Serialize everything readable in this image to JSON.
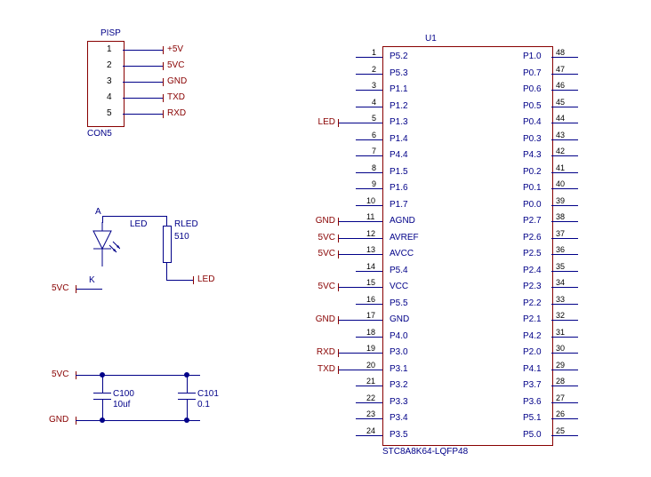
{
  "connector": {
    "title": "PISP",
    "footer": "CON5",
    "pins": [
      "1",
      "2",
      "3",
      "4",
      "5"
    ],
    "nets": [
      "+5V",
      "5VC",
      "GND",
      "TXD",
      "RXD"
    ]
  },
  "led_section": {
    "anode": "A",
    "cathode": "K",
    "ref": "LED",
    "res_ref": "RLED",
    "res_val": "510",
    "net_out": "LED",
    "net_vcc": "5VC"
  },
  "caps": {
    "net_vcc": "5VC",
    "net_gnd": "GND",
    "c1_ref": "C100",
    "c1_val": "10uf",
    "c2_ref": "C101",
    "c2_val": "0.1"
  },
  "chip": {
    "ref": "U1",
    "part": "STC8A8K64-LQFP48",
    "left_nets": {
      "5": "LED",
      "11": "GND",
      "12": "5VC",
      "13": "5VC",
      "15": "5VC",
      "17": "GND",
      "19": "RXD",
      "20": "TXD"
    },
    "rows": [
      {
        "lp": "1",
        "ll": "P5.2",
        "rl": "P1.0",
        "rp": "48"
      },
      {
        "lp": "2",
        "ll": "P5.3",
        "rl": "P0.7",
        "rp": "47"
      },
      {
        "lp": "3",
        "ll": "P1.1",
        "rl": "P0.6",
        "rp": "46"
      },
      {
        "lp": "4",
        "ll": "P1.2",
        "rl": "P0.5",
        "rp": "45"
      },
      {
        "lp": "5",
        "ll": "P1.3",
        "rl": "P0.4",
        "rp": "44"
      },
      {
        "lp": "6",
        "ll": "P1.4",
        "rl": "P0.3",
        "rp": "43"
      },
      {
        "lp": "7",
        "ll": "P4.4",
        "rl": "P4.3",
        "rp": "42"
      },
      {
        "lp": "8",
        "ll": "P1.5",
        "rl": "P0.2",
        "rp": "41"
      },
      {
        "lp": "9",
        "ll": "P1.6",
        "rl": "P0.1",
        "rp": "40"
      },
      {
        "lp": "10",
        "ll": "P1.7",
        "rl": "P0.0",
        "rp": "39"
      },
      {
        "lp": "11",
        "ll": "AGND",
        "rl": "P2.7",
        "rp": "38"
      },
      {
        "lp": "12",
        "ll": "AVREF",
        "rl": "P2.6",
        "rp": "37"
      },
      {
        "lp": "13",
        "ll": "AVCC",
        "rl": "P2.5",
        "rp": "36"
      },
      {
        "lp": "14",
        "ll": "P5.4",
        "rl": "P2.4",
        "rp": "35"
      },
      {
        "lp": "15",
        "ll": "VCC",
        "rl": "P2.3",
        "rp": "34"
      },
      {
        "lp": "16",
        "ll": "P5.5",
        "rl": "P2.2",
        "rp": "33"
      },
      {
        "lp": "17",
        "ll": "GND",
        "rl": "P2.1",
        "rp": "32"
      },
      {
        "lp": "18",
        "ll": "P4.0",
        "rl": "P4.2",
        "rp": "31"
      },
      {
        "lp": "19",
        "ll": "P3.0",
        "rl": "P2.0",
        "rp": "30"
      },
      {
        "lp": "20",
        "ll": "P3.1",
        "rl": "P4.1",
        "rp": "29"
      },
      {
        "lp": "21",
        "ll": "P3.2",
        "rl": "P3.7",
        "rp": "28"
      },
      {
        "lp": "22",
        "ll": "P3.3",
        "rl": "P3.6",
        "rp": "27"
      },
      {
        "lp": "23",
        "ll": "P3.4",
        "rl": "P5.1",
        "rp": "26"
      },
      {
        "lp": "24",
        "ll": "P3.5",
        "rl": "P5.0",
        "rp": "25"
      }
    ]
  }
}
